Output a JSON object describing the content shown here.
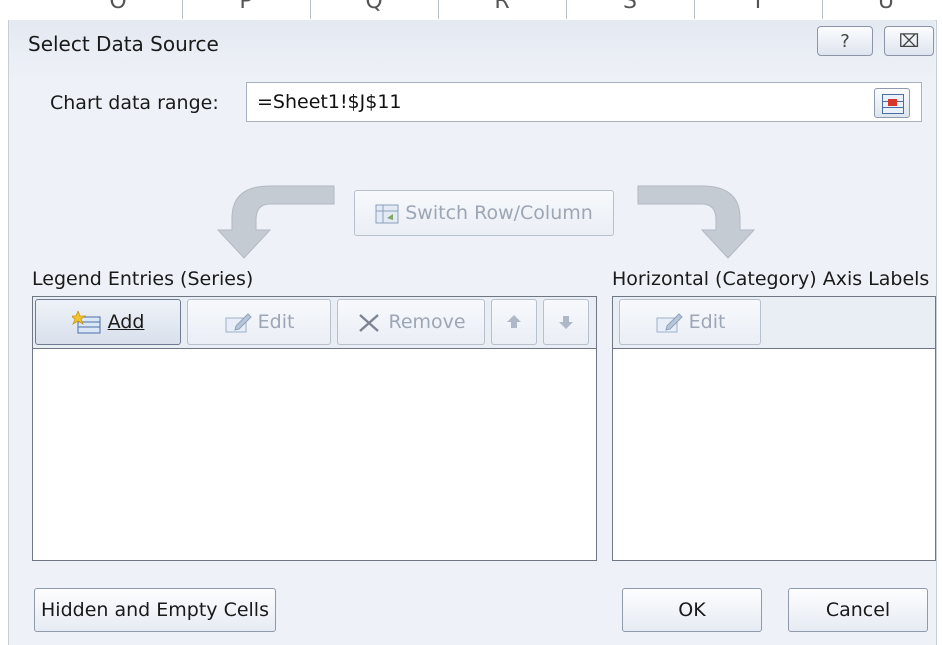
{
  "window": {
    "title": "Select Data Source",
    "help_glyph": "?",
    "close_glyph": "⌧"
  },
  "range": {
    "label": "Chart data range:",
    "value": "=Sheet1!$J$11"
  },
  "switch_button": {
    "label": "Switch Row/Column"
  },
  "legend": {
    "heading": "Legend Entries (Series)",
    "add_label": "Add",
    "edit_label": "Edit",
    "remove_label": "Remove"
  },
  "axis": {
    "heading": "Horizontal (Category) Axis Labels",
    "edit_label": "Edit"
  },
  "footer": {
    "hidden_cells_label": "Hidden and Empty Cells",
    "ok_label": "OK",
    "cancel_label": "Cancel"
  },
  "sheet": {
    "column_headers": [
      "O",
      "P",
      "Q",
      "R",
      "S",
      "T",
      "U"
    ]
  },
  "colors": {
    "accent_blue": "#4a6fa5",
    "arrow_gray": "#c5cbd3",
    "disabled_text": "#9da6b5"
  }
}
